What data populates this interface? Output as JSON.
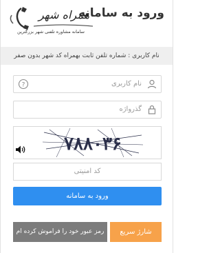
{
  "header": {
    "title": "ورود به سامانه"
  },
  "logo": {
    "name": "همراه شهر",
    "tagline": "سامانه مشاوره تلفنی شهر بزرگترین"
  },
  "hint": {
    "text": "نام کاربری : شماره تلفن ثابت بهمراه کد شهر بدون صفر"
  },
  "form": {
    "username_placeholder": "نام کاربری",
    "password_placeholder": "گذرواژه",
    "captcha_text": "۷۸۸۰۳۶",
    "security_code_placeholder": "کد امنیتی"
  },
  "buttons": {
    "login_label": "ورود به سامانه",
    "forgot_label": "رمز عبور خود را فراموش کرده ام",
    "quick_charge_label": "شارژ سریع"
  },
  "icons": {
    "user": "user-icon",
    "help": "help-icon",
    "lock": "lock-icon",
    "audio": "speaker-icon",
    "logo_phone": "phone-icon"
  },
  "colors": {
    "primary": "#2f8ff0",
    "secondary": "#7c7c7c",
    "accent": "#f7a24a",
    "hint_bg": "#efefef"
  }
}
